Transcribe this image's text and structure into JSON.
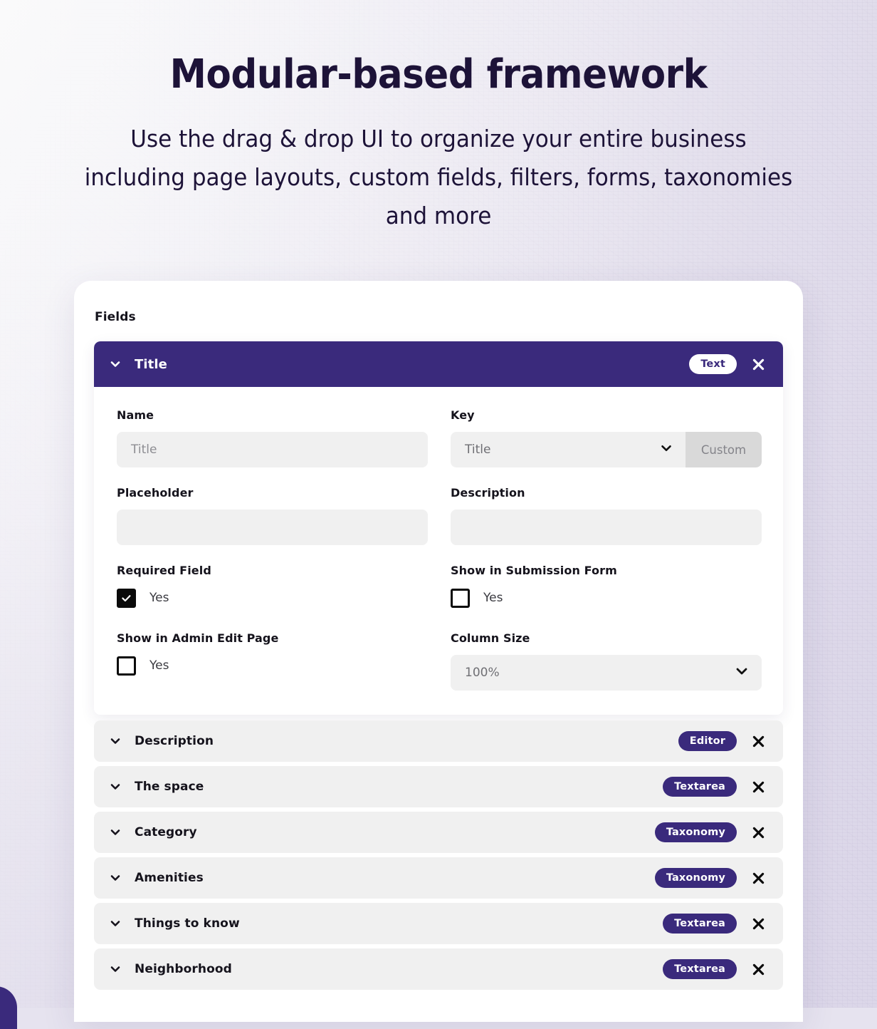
{
  "hero": {
    "title": "Modular-based framework",
    "subtitle": "Use the drag & drop UI to organize your entire business including page layouts, custom fields, filters, forms, taxonomies and more"
  },
  "panel": {
    "section_label": "Fields",
    "expanded_field": {
      "title": "Title",
      "type_badge": "Text",
      "close_label": "✕",
      "name": {
        "label": "Name",
        "placeholder": "Title",
        "value": ""
      },
      "key": {
        "label": "Key",
        "selected": "Title",
        "suffix_button": "Custom"
      },
      "placeholder_field": {
        "label": "Placeholder",
        "value": ""
      },
      "description_field": {
        "label": "Description",
        "value": ""
      },
      "required_field": {
        "label": "Required Field",
        "option": "Yes",
        "checked": true
      },
      "show_in_submission_form": {
        "label": "Show in Submission Form",
        "option": "Yes",
        "checked": false
      },
      "show_in_admin_edit_page": {
        "label": "Show in Admin Edit Page",
        "option": "Yes",
        "checked": false
      },
      "column_size": {
        "label": "Column Size",
        "selected": "100%"
      }
    },
    "collapsed_fields": [
      {
        "title": "Description",
        "badge": "Editor"
      },
      {
        "title": "The space",
        "badge": "Textarea"
      },
      {
        "title": "Category",
        "badge": "Taxonomy"
      },
      {
        "title": "Amenities",
        "badge": "Taxonomy"
      },
      {
        "title": "Things to know",
        "badge": "Textarea"
      },
      {
        "title": "Neighborhood",
        "badge": "Textarea"
      }
    ]
  },
  "colors": {
    "brand_purple": "#3a2a7c",
    "ink": "#1d1338",
    "input_gray": "#f0f0f0",
    "suffix_gray": "#d9d9d9",
    "page_bg_light": "#f6f5f8",
    "page_bg_lavender": "#ddd8e9"
  }
}
